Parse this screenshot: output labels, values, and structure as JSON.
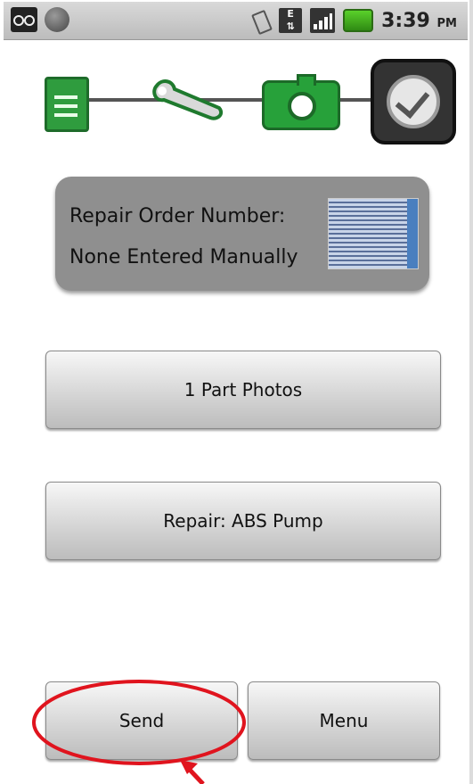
{
  "status_bar": {
    "time": "3:39",
    "ampm": "PM",
    "network_label": "E",
    "icons": [
      "voicemail-icon",
      "notification-dot-icon",
      "vibrate-icon",
      "network-data-icon",
      "signal-icon",
      "battery-icon"
    ]
  },
  "workflow": {
    "steps": [
      "document-icon",
      "wrench-icon",
      "camera-icon",
      "check-icon"
    ]
  },
  "repair_order": {
    "label": "Repair Order Number:",
    "value": "None Entered Manually"
  },
  "buttons": {
    "parts_photos": "1 Part Photos",
    "repair": "Repair: ABS Pump",
    "send": "Send",
    "menu": "Menu"
  },
  "colors": {
    "accent_green": "#2f9c3e",
    "annotation_red": "#e0141e",
    "panel_gray": "#8f8f8f"
  }
}
